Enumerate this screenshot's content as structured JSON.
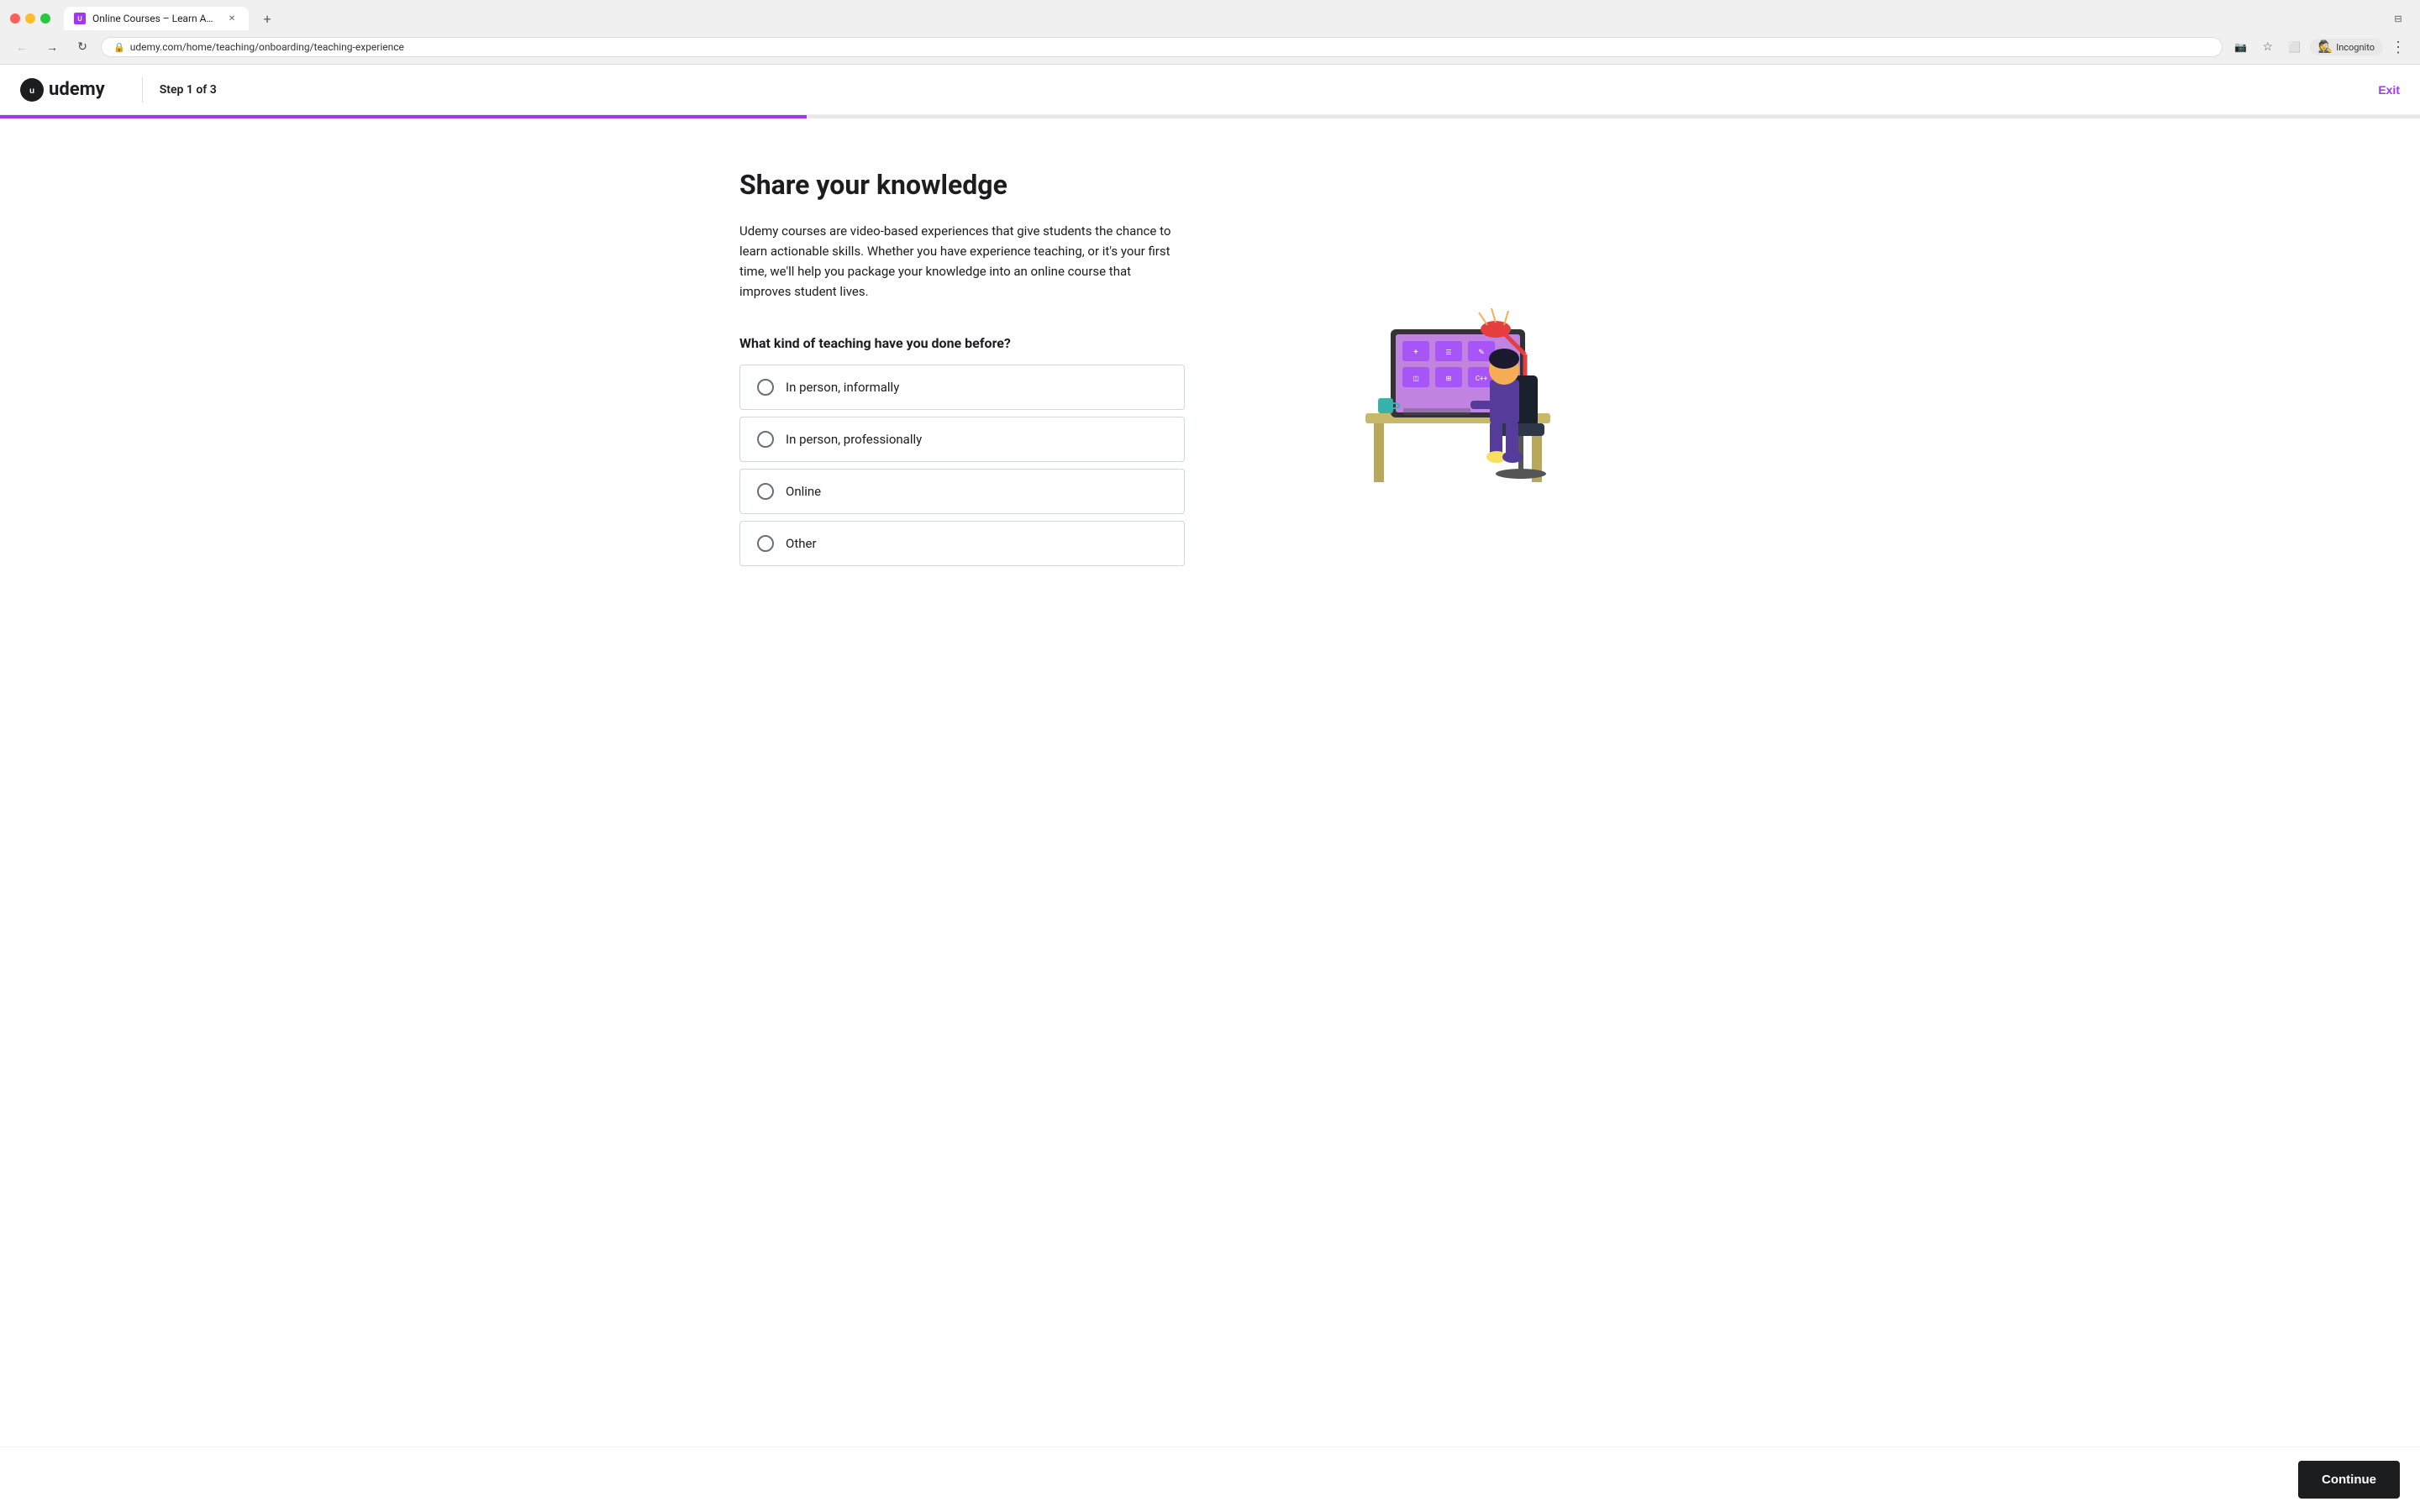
{
  "browser": {
    "tab_title": "Online Courses – Learn Anyth…",
    "url": "udemy.com/home/teaching/onboarding/teaching-experience",
    "incognito_label": "Incognito"
  },
  "header": {
    "logo_text": "udemy",
    "step_label": "Step 1 of 3",
    "exit_label": "Exit"
  },
  "progress": {
    "percent": 33.33
  },
  "page": {
    "title": "Share your knowledge",
    "description": "Udemy courses are video-based experiences that give students the chance to learn actionable skills. Whether you have experience teaching, or it's your first time, we'll help you package your knowledge into an online course that improves student lives.",
    "question": "What kind of teaching have you done before?",
    "options": [
      {
        "id": "in-person-informally",
        "label": "In person, informally"
      },
      {
        "id": "in-person-professionally",
        "label": "In person, professionally"
      },
      {
        "id": "online",
        "label": "Online"
      },
      {
        "id": "other",
        "label": "Other"
      }
    ],
    "continue_label": "Continue"
  }
}
